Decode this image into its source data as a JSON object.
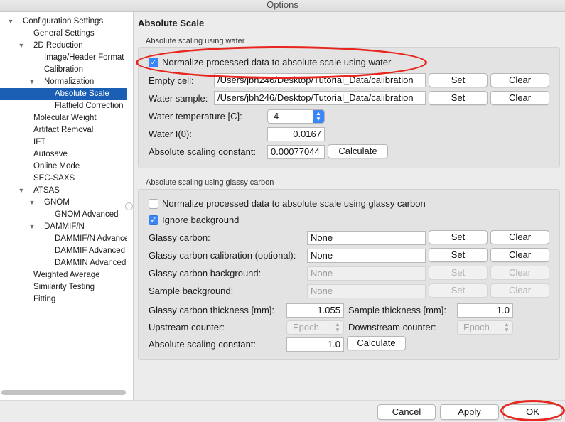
{
  "window": {
    "title": "Options"
  },
  "tree": {
    "items": [
      {
        "label": "Configuration Settings",
        "expanded": true
      },
      {
        "label": "General Settings"
      },
      {
        "label": "2D Reduction",
        "expanded": true
      },
      {
        "label": "Image/Header Format"
      },
      {
        "label": "Calibration"
      },
      {
        "label": "Normalization",
        "expanded": true
      },
      {
        "label": "Absolute Scale",
        "selected": true
      },
      {
        "label": "Flatfield Correction"
      },
      {
        "label": "Molecular Weight"
      },
      {
        "label": "Artifact Removal"
      },
      {
        "label": "IFT"
      },
      {
        "label": "Autosave"
      },
      {
        "label": "Online Mode"
      },
      {
        "label": "SEC-SAXS"
      },
      {
        "label": "ATSAS",
        "expanded": true
      },
      {
        "label": "GNOM",
        "expanded": true
      },
      {
        "label": "GNOM Advanced"
      },
      {
        "label": "DAMMIF/N",
        "expanded": true
      },
      {
        "label": "DAMMIF/N Advanced"
      },
      {
        "label": "DAMMIF Advanced"
      },
      {
        "label": "DAMMIN Advanced"
      },
      {
        "label": "Weighted Average"
      },
      {
        "label": "Similarity Testing"
      },
      {
        "label": "Fitting"
      }
    ]
  },
  "panel": {
    "title": "Absolute Scale"
  },
  "water": {
    "group_label": "Absolute scaling using water",
    "normalize_label": "Normalize processed data to absolute scale using water",
    "normalize_checked": true,
    "empty_cell_label": "Empty cell:",
    "empty_cell_value": "/Users/jbh246/Desktop/Tutorial_Data/calibration",
    "water_sample_label": "Water sample:",
    "water_sample_value": "/Users/jbh246/Desktop/Tutorial_Data/calibration",
    "set_label": "Set",
    "clear_label": "Clear",
    "temperature_label": "Water temperature [C]:",
    "temperature_value": "4",
    "i0_label": "Water I(0):",
    "i0_value": "0.0167",
    "constant_label": "Absolute scaling constant:",
    "constant_value": "0.00077044",
    "calculate_label": "Calculate"
  },
  "glassy": {
    "group_label": "Absolute scaling using glassy carbon",
    "normalize_label": "Normalize processed data to absolute scale using glassy carbon",
    "normalize_checked": false,
    "ignore_bg_label": "Ignore background",
    "ignore_bg_checked": true,
    "carbon_label": "Glassy carbon:",
    "carbon_value": "None",
    "calibration_label": "Glassy carbon calibration (optional):",
    "calibration_value": "None",
    "carbon_bg_label": "Glassy carbon background:",
    "carbon_bg_value": "None",
    "sample_bg_label": "Sample background:",
    "sample_bg_value": "None",
    "set_label": "Set",
    "clear_label": "Clear",
    "carbon_thickness_label": "Glassy carbon thickness [mm]:",
    "carbon_thickness_value": "1.055",
    "sample_thickness_label": "Sample thickness [mm]:",
    "sample_thickness_value": "1.0",
    "upstream_label": "Upstream counter:",
    "upstream_value": "Epoch",
    "downstream_label": "Downstream counter:",
    "downstream_value": "Epoch",
    "constant_label": "Absolute scaling constant:",
    "constant_value": "1.0",
    "calculate_label": "Calculate"
  },
  "footer": {
    "cancel_label": "Cancel",
    "apply_label": "Apply",
    "ok_label": "OK"
  },
  "colors": {
    "selection": "#1a5fb4",
    "checkbox": "#3b86f6",
    "annotation": "#e8261f"
  }
}
